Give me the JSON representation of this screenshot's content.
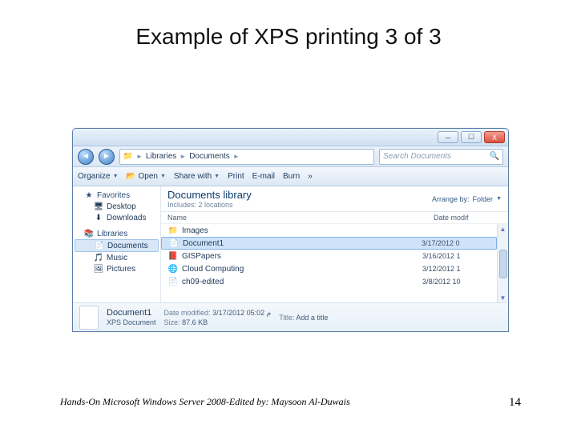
{
  "slide": {
    "title": "Example of XPS printing 3 of 3",
    "credit": "Hands-On Microsoft Windows Server 2008-Edited by: Maysoon Al-Duwais",
    "page_number": "14"
  },
  "window": {
    "controls": {
      "min": "─",
      "max": "☐",
      "close": "X"
    },
    "nav_back": "◄",
    "nav_fwd": "►",
    "breadcrumb": {
      "part1": "Libraries",
      "part2": "Documents",
      "sep": "►"
    },
    "search_placeholder": "Search Documents",
    "toolbar": {
      "organize": "Organize",
      "open": "Open",
      "share": "Share with",
      "print": "Print",
      "email": "E-mail",
      "burn": "Burn",
      "more": "»"
    },
    "navpane": {
      "favorites": "Favorites",
      "fav_items": [
        "Desktop",
        "Downloads"
      ],
      "libraries": "Libraries",
      "lib_items": [
        "Documents",
        "Music",
        "Pictures"
      ]
    },
    "library_header": {
      "title": "Documents library",
      "subtitle": "Includes: 2 locations"
    },
    "arrange": {
      "label": "Arrange by:",
      "value": "Folder"
    },
    "columns": {
      "name": "Name",
      "date": "Date modif"
    },
    "files": [
      {
        "icon": "📁",
        "name": "Images",
        "date": ""
      },
      {
        "icon": "📄",
        "name": "Document1",
        "date": "3/17/2012 0",
        "sel": true
      },
      {
        "icon": "📕",
        "name": "GISPapers",
        "date": "3/16/2012 1"
      },
      {
        "icon": "🌐",
        "name": "Cloud Computing",
        "date": "3/12/2012 1"
      },
      {
        "icon": "📄",
        "name": "ch09-edited",
        "date": "3/8/2012 10"
      }
    ],
    "details": {
      "name": "Document1",
      "type": "XPS Document",
      "date_label": "Date modified:",
      "date": "3/17/2012 05:02 م",
      "size_label": "Size:",
      "size": "87.6 KB",
      "title_label": "Title:",
      "title_value": "Add a title"
    }
  }
}
